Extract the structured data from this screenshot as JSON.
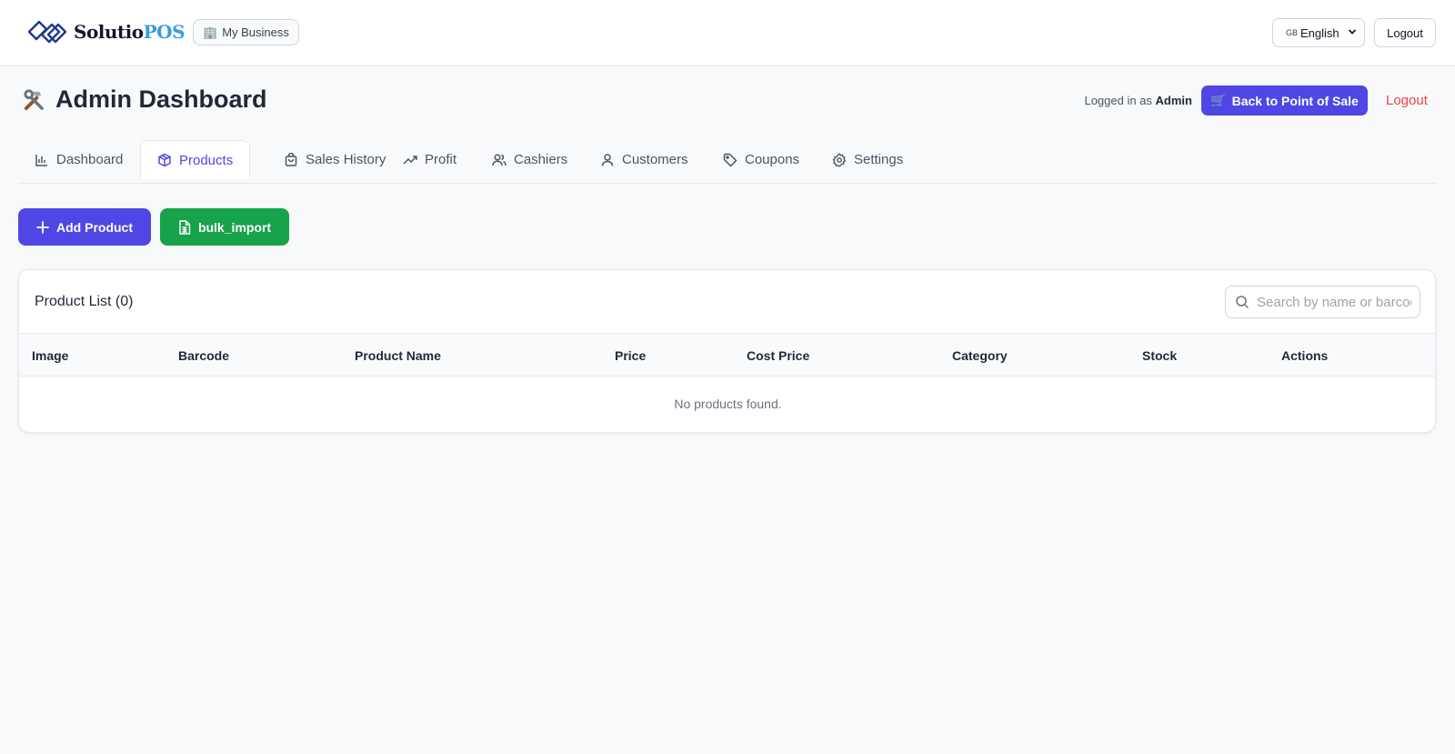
{
  "brand": {
    "name_part1": "Solutio",
    "name_part2": "POS",
    "color_primary": "#111827",
    "color_accent": "#3b9be0"
  },
  "topbar": {
    "business_button": "My Business",
    "language": {
      "flag": "GB",
      "selected": "English"
    },
    "logout_label": "Logout"
  },
  "header": {
    "icon": "hammer-wrench-icon",
    "title": "Admin Dashboard",
    "logged_in_prefix": "Logged in as",
    "logged_in_user": "Admin",
    "back_to_pos_label": "Back to Point of Sale",
    "logout_label": "Logout"
  },
  "tabs": [
    {
      "label": "Dashboard",
      "icon": "bar-chart-icon",
      "active": false
    },
    {
      "label": "Products",
      "icon": "package-icon",
      "active": true
    },
    {
      "label": "Sales History",
      "icon": "shopping-bag-icon",
      "active": false
    },
    {
      "label": "Profit",
      "icon": "trending-up-icon",
      "active": false
    },
    {
      "label": "Cashiers",
      "icon": "users-icon",
      "active": false
    },
    {
      "label": "Customers",
      "icon": "user-icon",
      "active": false
    },
    {
      "label": "Coupons",
      "icon": "tag-icon",
      "active": false
    },
    {
      "label": "Settings",
      "icon": "gear-icon",
      "active": false
    }
  ],
  "actions": {
    "add_product_label": "Add Product",
    "bulk_import_label": "bulk_import"
  },
  "product_list": {
    "title": "Product List (0)",
    "search_placeholder": "Search by name or barcode",
    "columns": [
      "Image",
      "Barcode",
      "Product Name",
      "Price",
      "Cost Price",
      "Category",
      "Stock",
      "Actions"
    ],
    "rows": [],
    "empty_message": "No products found."
  },
  "colors": {
    "primary": "#4f46e5",
    "success": "#16a34a",
    "danger": "#ef4444"
  }
}
